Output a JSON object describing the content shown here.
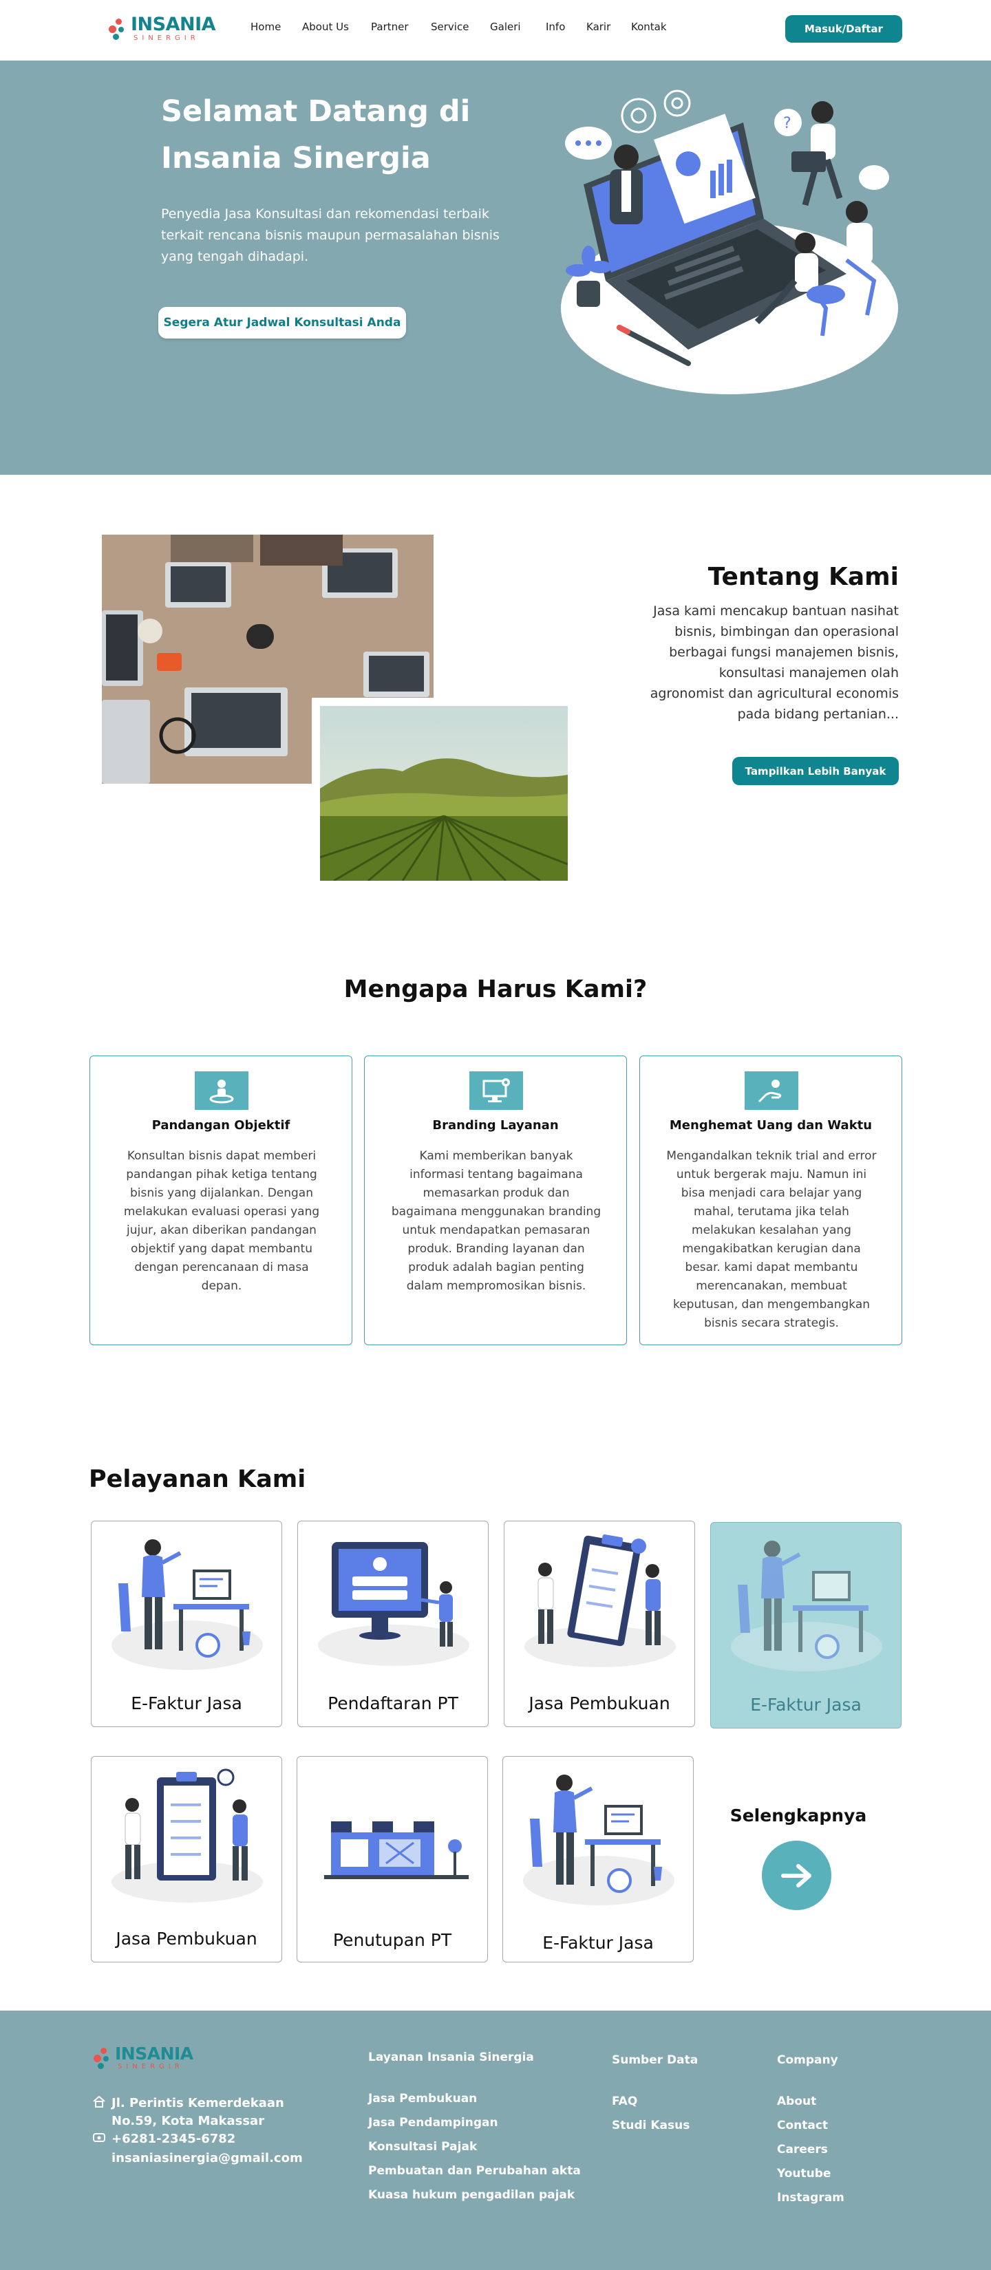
{
  "brand": {
    "name": "INSANIA",
    "sub": "SINERGIR"
  },
  "nav": {
    "items": [
      "Home",
      "About Us",
      "Partner",
      "Service",
      "Galeri",
      "Info",
      "Karir",
      "Kontak"
    ],
    "login": "Masuk/Daftar"
  },
  "hero": {
    "title_line1": "Selamat Datang di",
    "title_line2": "Insania Sinergia",
    "desc": "Penyedia  Jasa Konsultasi dan  rekomendasi terbaik terkait rencana bisnis maupun permasalahan bisnis yang tengah dihadapi.",
    "cta": "Segera Atur Jadwal Konsultasi Anda"
  },
  "about": {
    "title": "Tentang Kami",
    "text": "Jasa kami mencakup bantuan nasihat bisnis, bimbingan dan operasional berbagai fungsi manajemen bisnis, konsultasi manajemen olah agronomist dan agricultural economis pada bidang pertanian...",
    "button": "Tampilkan Lebih Banyak"
  },
  "why": {
    "title": "Mengapa Harus Kami?",
    "cards": [
      {
        "icon": "person-target-icon",
        "title": "Pandangan Objektif",
        "text": "Konsultan bisnis dapat memberi pandangan pihak ketiga tentang bisnis yang dijalankan. Dengan melakukan evaluasi operasi yang jujur, akan diberikan pandangan objektif yang dapat membantu dengan perencanaan di masa depan."
      },
      {
        "icon": "monitor-gear-icon",
        "title": "Branding Layanan",
        "text": "Kami memberikan banyak informasi tentang bagaimana memasarkan produk dan bagaimana menggunakan branding untuk mendapatkan pemasaran produk. Branding layanan dan produk adalah bagian penting dalam mempromosikan bisnis."
      },
      {
        "icon": "hand-coin-icon",
        "title": "Menghemat Uang dan Waktu",
        "text": "Mengandalkan teknik trial and error untuk bergerak maju. Namun ini bisa menjadi cara belajar yang mahal, terutama jika telah melakukan kesalahan yang mengakibatkan kerugian dana besar. kami dapat membantu merencanakan, membuat keputusan, dan mengembangkan bisnis secara strategis."
      }
    ]
  },
  "services": {
    "title": "Pelayanan Kami",
    "items": [
      {
        "label": "E-Faktur Jasa",
        "illustration": "woman-desk-illustration"
      },
      {
        "label": "Pendaftaran PT",
        "illustration": "monitor-registration-illustration"
      },
      {
        "label": "Jasa Pembukuan",
        "illustration": "clipboard-people-illustration"
      },
      {
        "label": "E-Faktur Jasa",
        "illustration": "woman-desk-illustration"
      },
      {
        "label": "Jasa Pembukuan",
        "illustration": "clipboard-people-illustration"
      },
      {
        "label": "Penutupan PT",
        "illustration": "storefront-illustration"
      },
      {
        "label": "E-Faktur Jasa",
        "illustration": "woman-desk-illustration"
      }
    ],
    "more": "Selengkapnya"
  },
  "footer": {
    "address_line1": "Jl. Perintis Kemerdekaan",
    "address_line2": "No.59, Kota Makassar",
    "phone": "+6281-2345-6782",
    "email": "insaniasinergia@gmail.com",
    "col1": {
      "head": "Layanan Insania Sinergia",
      "items": [
        "Jasa Pembukuan",
        "Jasa Pendampingan",
        "Konsultasi Pajak",
        "Pembuatan dan Perubahan akta",
        "Kuasa hukum pengadilan pajak"
      ]
    },
    "col2": {
      "head": "Sumber Data",
      "items": [
        "FAQ",
        "Studi Kasus"
      ]
    },
    "col3": {
      "head": "Company",
      "items": [
        "About",
        "Contact",
        "Careers",
        "Youtube",
        "Instagram"
      ]
    }
  },
  "colors": {
    "primary": "#0f8590",
    "hero_bg": "#84a8b0",
    "card_border": "#4ba0ae",
    "icon_bg": "#59b1bc",
    "accent_red": "#e8564e"
  }
}
